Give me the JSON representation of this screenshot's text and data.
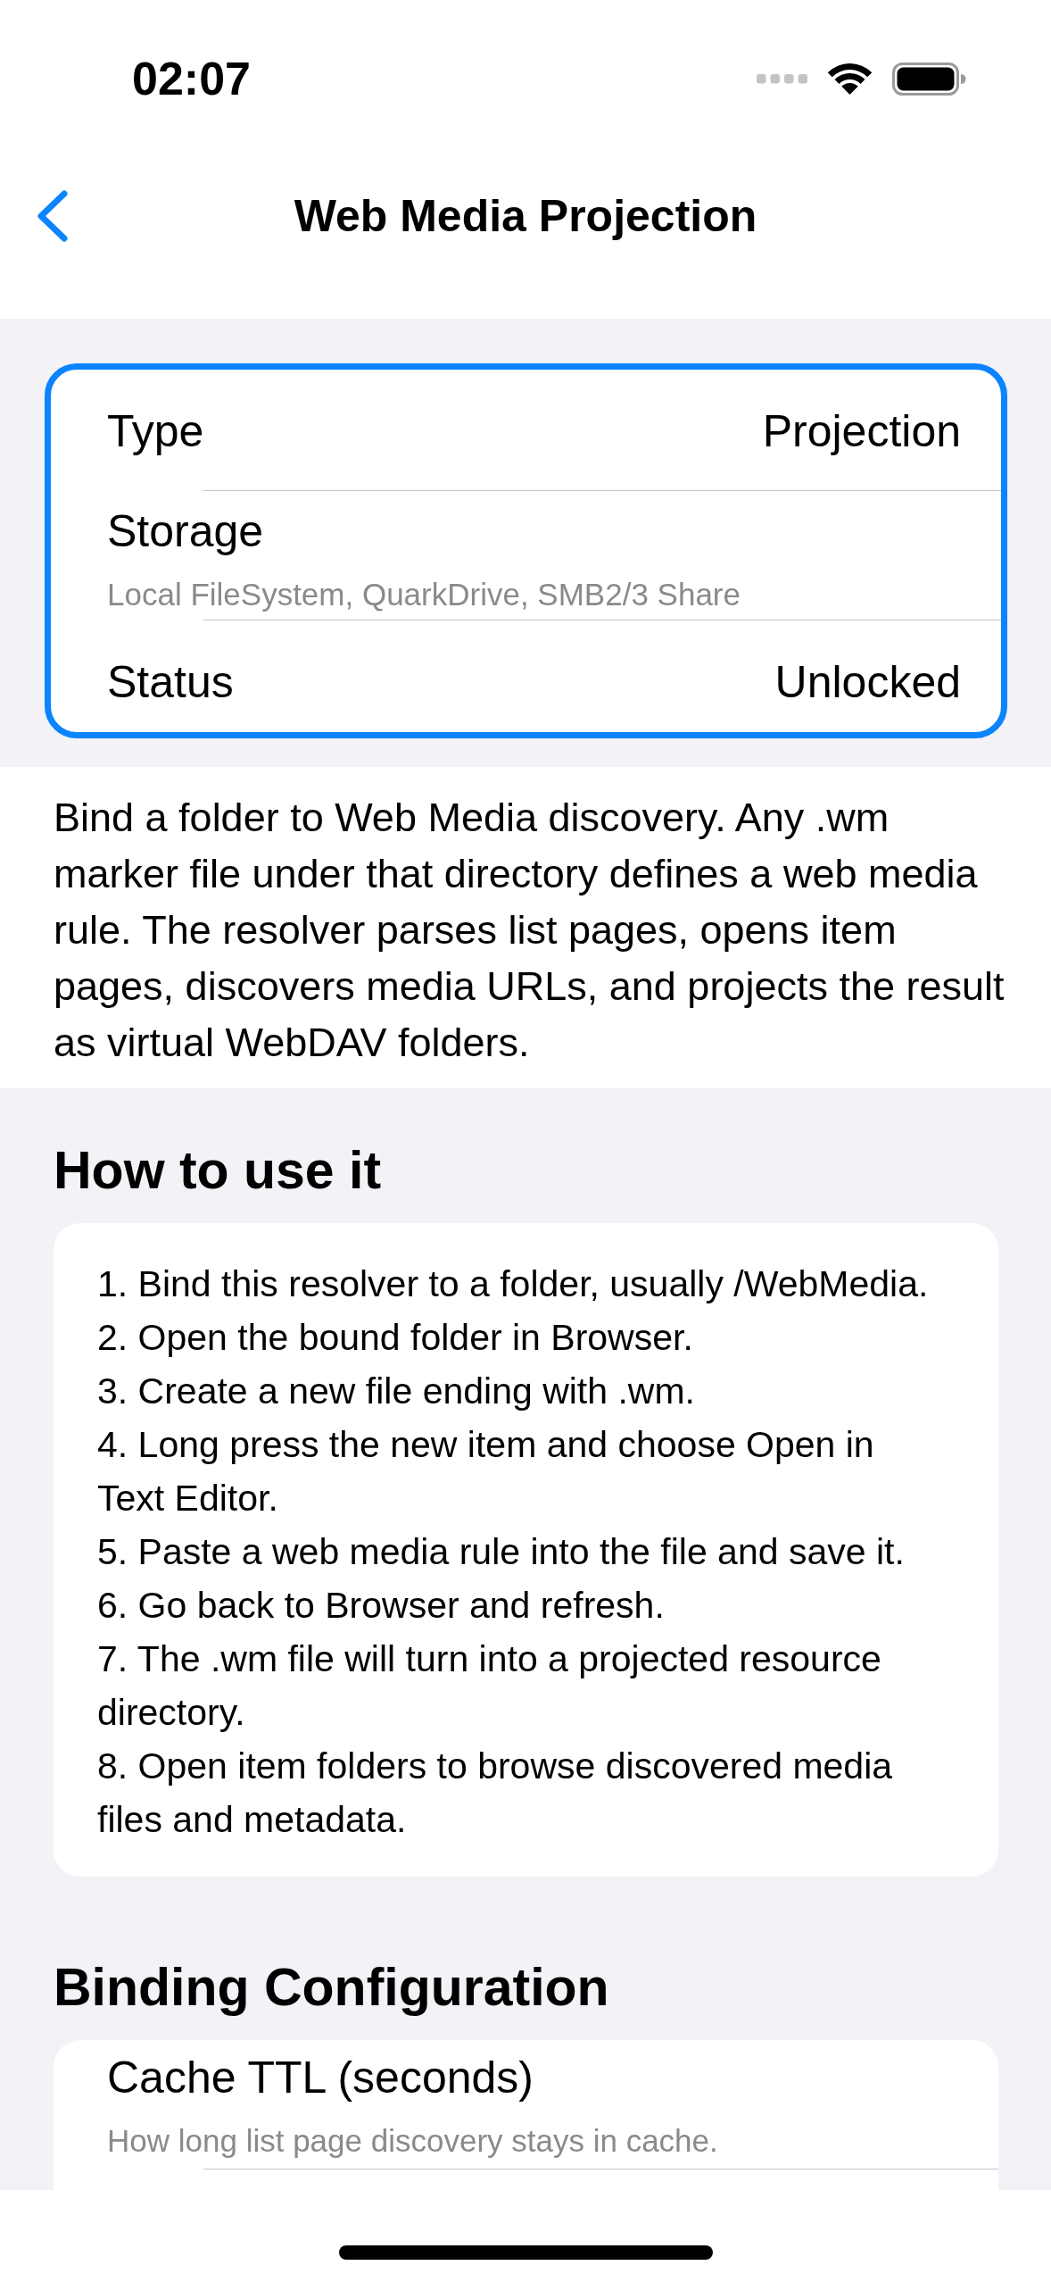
{
  "status_bar": {
    "time": "02:07"
  },
  "nav_bar": {
    "title": "Web Media Projection"
  },
  "info_card": {
    "highlighted": true,
    "rows": [
      {
        "kind": "value",
        "label": "Type",
        "value": "Projection"
      },
      {
        "kind": "detail",
        "label": "Storage",
        "detail": "Local FileSystem, QuarkDrive, SMB2/3 Share"
      },
      {
        "kind": "value",
        "label": "Status",
        "value": "Unlocked"
      }
    ]
  },
  "description": "Bind a folder to Web Media discovery. Any .wm marker file under that directory defines a web media rule. The resolver parses list pages, opens item pages, discovers media URLs, and projects the result as virtual WebDAV folders.",
  "sections": [
    {
      "kind": "steps",
      "title": "How to use it",
      "steps": [
        "1. Bind this resolver to a folder, usually /WebMedia.",
        "2. Open the bound folder in Browser.",
        "3. Create a new file ending with .wm.",
        "4. Long press the new item and choose Open in Text Editor.",
        "5. Paste a web media rule into the file and save it.",
        "6. Go back to Browser and refresh.",
        "7. The .wm file will turn into a projected resource directory.",
        "8. Open item folders to browse discovered media files and metadata."
      ]
    },
    {
      "kind": "settings",
      "title": "Binding Configuration",
      "rows": [
        {
          "label": "Cache TTL (seconds)",
          "detail": "How long list page discovery stays in cache."
        }
      ]
    }
  ]
}
